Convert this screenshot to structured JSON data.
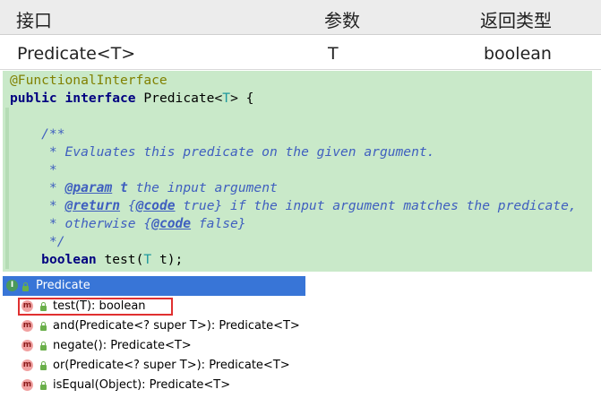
{
  "table": {
    "headers": [
      "接口",
      "参数",
      "返回类型"
    ],
    "row": [
      "Predicate<T>",
      "T",
      "boolean"
    ]
  },
  "code": {
    "lines": [
      {
        "parts": [
          {
            "text": "@FunctionalInterface",
            "style": "annotation"
          }
        ]
      },
      {
        "parts": [
          {
            "text": "public ",
            "style": "kw"
          },
          {
            "text": "interface ",
            "style": "kw"
          },
          {
            "text": "Predicate<",
            "style": "plain"
          },
          {
            "text": "T",
            "style": "typeparam"
          },
          {
            "text": "> {",
            "style": "plain"
          }
        ]
      },
      {
        "parts": [
          {
            "text": "",
            "style": "plain"
          }
        ]
      },
      {
        "parts": [
          {
            "text": "    /**",
            "style": "doc"
          }
        ]
      },
      {
        "parts": [
          {
            "text": "     * Evaluates this predicate on the given argument.",
            "style": "doc"
          }
        ]
      },
      {
        "parts": [
          {
            "text": "     *",
            "style": "doc"
          }
        ]
      },
      {
        "parts": [
          {
            "text": "     * ",
            "style": "doc"
          },
          {
            "text": "@param",
            "style": "doctag"
          },
          {
            "text": " ",
            "style": "doc"
          },
          {
            "text": "t",
            "style": "docbold"
          },
          {
            "text": " the input argument",
            "style": "doc"
          }
        ]
      },
      {
        "parts": [
          {
            "text": "     * ",
            "style": "doc"
          },
          {
            "text": "@return",
            "style": "doctag"
          },
          {
            "text": " {",
            "style": "doc"
          },
          {
            "text": "@code",
            "style": "doctag"
          },
          {
            "text": " true} if the input argument matches the predicate,",
            "style": "doc"
          }
        ]
      },
      {
        "parts": [
          {
            "text": "     * otherwise {",
            "style": "doc"
          },
          {
            "text": "@code",
            "style": "doctag"
          },
          {
            "text": " false}",
            "style": "doc"
          }
        ]
      },
      {
        "parts": [
          {
            "text": "     */",
            "style": "doc"
          }
        ]
      },
      {
        "parts": [
          {
            "text": "    ",
            "style": "plain"
          },
          {
            "text": "boolean ",
            "style": "kw"
          },
          {
            "text": "test(",
            "style": "plain"
          },
          {
            "text": "T",
            "style": "typeparam"
          },
          {
            "text": " t);",
            "style": "plain"
          }
        ]
      }
    ]
  },
  "structure": {
    "root": {
      "badge": "I",
      "label": "Predicate"
    },
    "methods": [
      {
        "badge": "m",
        "label": "test(T): boolean"
      },
      {
        "badge": "m",
        "label": "and(Predicate<? super T>): Predicate<T>"
      },
      {
        "badge": "m",
        "label": "negate(): Predicate<T>"
      },
      {
        "badge": "m",
        "label": "or(Predicate<? super T>): Predicate<T>"
      },
      {
        "badge": "m",
        "label": "isEqual(Object): Predicate<T>"
      }
    ]
  }
}
